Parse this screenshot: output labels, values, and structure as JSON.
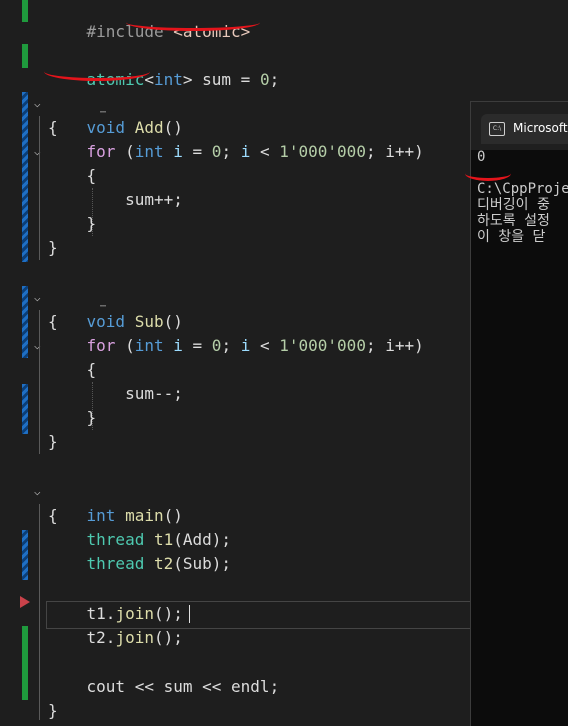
{
  "code": {
    "include_directive": "#include",
    "include_header": "<atomic>",
    "atomic_type": "atomic",
    "lt": "<",
    "int_kw": "int",
    "gt": ">",
    "sum_decl_rest": " sum = ",
    "zero": "0",
    "semi": ";",
    "void_kw": "void",
    "add_name": "Add",
    "sub_name": "Sub",
    "parens": "()",
    "open_brace": "{",
    "close_brace": "}",
    "for_kw": "for",
    "for_open": " (",
    "i_var": "i",
    "eq": " = ",
    "zero_i": "0",
    "cond_mid": "; ",
    "lt_op": " < ",
    "limit": "1'000'000",
    "incr": "; i++)",
    "sum_inc": "sum++;",
    "sum_dec": "sum--;",
    "main_name": "main",
    "thread_kw": "thread",
    "t1_decl": "t1",
    "t1_arg": "(Add);",
    "t2_decl": "t2",
    "t2_arg": "(Sub);",
    "t1_join_obj": "t1",
    "t1_join_dot": ".",
    "join_fn": "join",
    "join_call": "();",
    "t2_join_obj": "t2",
    "cout_line_a": "cout << ",
    "cout_sum": "sum",
    "cout_line_b": " << endl;"
  },
  "console": {
    "tab_title": "Microsoft",
    "icon_text": "C:\\",
    "output_value": "0",
    "path_line": "C:\\CppProje",
    "msg_line1": "디버깅이 중",
    "msg_line2": "하도록 설정",
    "msg_line3": "이 창을 닫"
  },
  "colors": {
    "background": "#1e1e1e",
    "change_bar_saved": "#1f9a3d",
    "change_bar_unsaved": "#1f6fc4",
    "breakpoint_arrow": "#c9424a",
    "annotation_red": "#e4141b"
  }
}
